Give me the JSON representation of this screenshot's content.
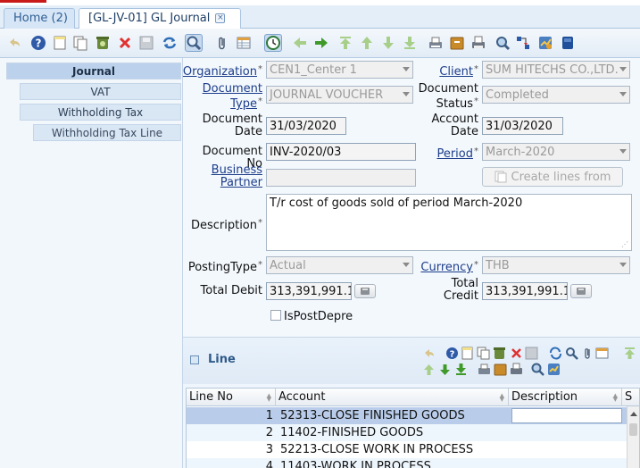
{
  "tabs": [
    {
      "label": "Home (2)"
    },
    {
      "label": "[GL-JV-01] GL Journal",
      "close": "×"
    }
  ],
  "toolbar_icons": [
    "undo-icon",
    "help-icon",
    "new-record-icon",
    "copy-record-icon",
    "delete-icon",
    "delete-selection-icon",
    "save-icon",
    "refresh-icon",
    "find-icon",
    "attachment-icon",
    "grid-toggle-icon",
    "history-icon",
    "parent-record-icon",
    "detail-record-icon",
    "first-record-icon",
    "previous-record-icon",
    "next-record-icon",
    "last-record-icon",
    "report-icon",
    "archive-icon",
    "print-icon",
    "zoom-across-icon",
    "workflow-icon",
    "process-icon",
    "product-info-icon"
  ],
  "sidebar": {
    "items": [
      {
        "label": "Journal"
      },
      {
        "label": "VAT"
      },
      {
        "label": "Withholding Tax"
      },
      {
        "label": "Withholding Tax Line"
      }
    ]
  },
  "form": {
    "organization": {
      "label": "Organization",
      "value": "CEN1_Center 1"
    },
    "client": {
      "label": "Client",
      "value": "SUM HITECHS CO.,LTD."
    },
    "document_type": {
      "label1": "Document",
      "label2": "Type",
      "value": "JOURNAL VOUCHER"
    },
    "document_status": {
      "label1": "Document",
      "label2": "Status",
      "value": "Completed"
    },
    "document_date": {
      "label1": "Document",
      "label2": "Date",
      "value": "31/03/2020"
    },
    "account_date": {
      "label1": "Account",
      "label2": "Date",
      "value": "31/03/2020"
    },
    "document_no": {
      "label": "Document No",
      "value": "INV-2020/03"
    },
    "period": {
      "label": "Period",
      "value": "March-2020"
    },
    "business_partner": {
      "label1": "Business",
      "label2": "Partner",
      "value": ""
    },
    "create_lines_button": "Create lines from",
    "description": {
      "label": "Description",
      "value": "T/r cost of goods sold of period March-2020"
    },
    "posting_type": {
      "label": "PostingType",
      "value": "Actual"
    },
    "currency": {
      "label": "Currency",
      "value": "THB"
    },
    "total_debit": {
      "label": "Total Debit",
      "value": "313,391,991.1"
    },
    "total_credit": {
      "label1": "Total",
      "label2": "Credit",
      "value": "313,391,991.1"
    },
    "is_post_depre": {
      "label": "IsPostDepre",
      "checked": false
    },
    "required_mark": "*"
  },
  "line": {
    "title": "Line",
    "columns": [
      "Line No",
      "Account",
      "Description",
      "S"
    ],
    "rows": [
      {
        "no": "1",
        "account": "52313-CLOSE FINISHED GOODS",
        "description": ""
      },
      {
        "no": "2",
        "account": "11402-FINISHED GOODS",
        "description": ""
      },
      {
        "no": "3",
        "account": "52213-CLOSE WORK IN PROCESS",
        "description": ""
      },
      {
        "no": "4",
        "account": "11403-WORK IN PROCESS",
        "description": ""
      }
    ]
  },
  "colors": {
    "tab_active_text": "#1f3f66",
    "link_label": "#1c3d8a",
    "selected_row": "#b9cdea"
  }
}
